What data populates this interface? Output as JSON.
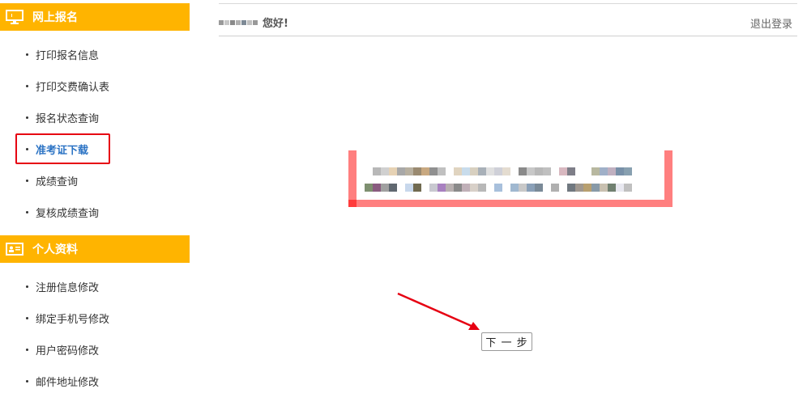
{
  "sidebar": {
    "sections": [
      {
        "title": "网上报名",
        "icon": "monitor-icon",
        "items": [
          {
            "label": "打印报名信息"
          },
          {
            "label": "打印交费确认表"
          },
          {
            "label": "报名状态查询"
          },
          {
            "label": "准考证下载",
            "active": true
          },
          {
            "label": "成绩查询"
          },
          {
            "label": "复核成绩查询"
          }
        ]
      },
      {
        "title": "个人资料",
        "icon": "id-card-icon",
        "items": [
          {
            "label": "注册信息修改"
          },
          {
            "label": "绑定手机号修改"
          },
          {
            "label": "用户密码修改"
          },
          {
            "label": "邮件地址修改"
          }
        ]
      }
    ]
  },
  "header": {
    "greeting": "您好!",
    "logout_label": "退出登录"
  },
  "main": {
    "next_button_label": "下 一 步"
  },
  "colors": {
    "section_header_bg": "#ffb400",
    "active_item": "#2b73c4",
    "highlight_border": "#e60012",
    "notice_border": "#ff7f7f",
    "arrow": "#e60012"
  }
}
